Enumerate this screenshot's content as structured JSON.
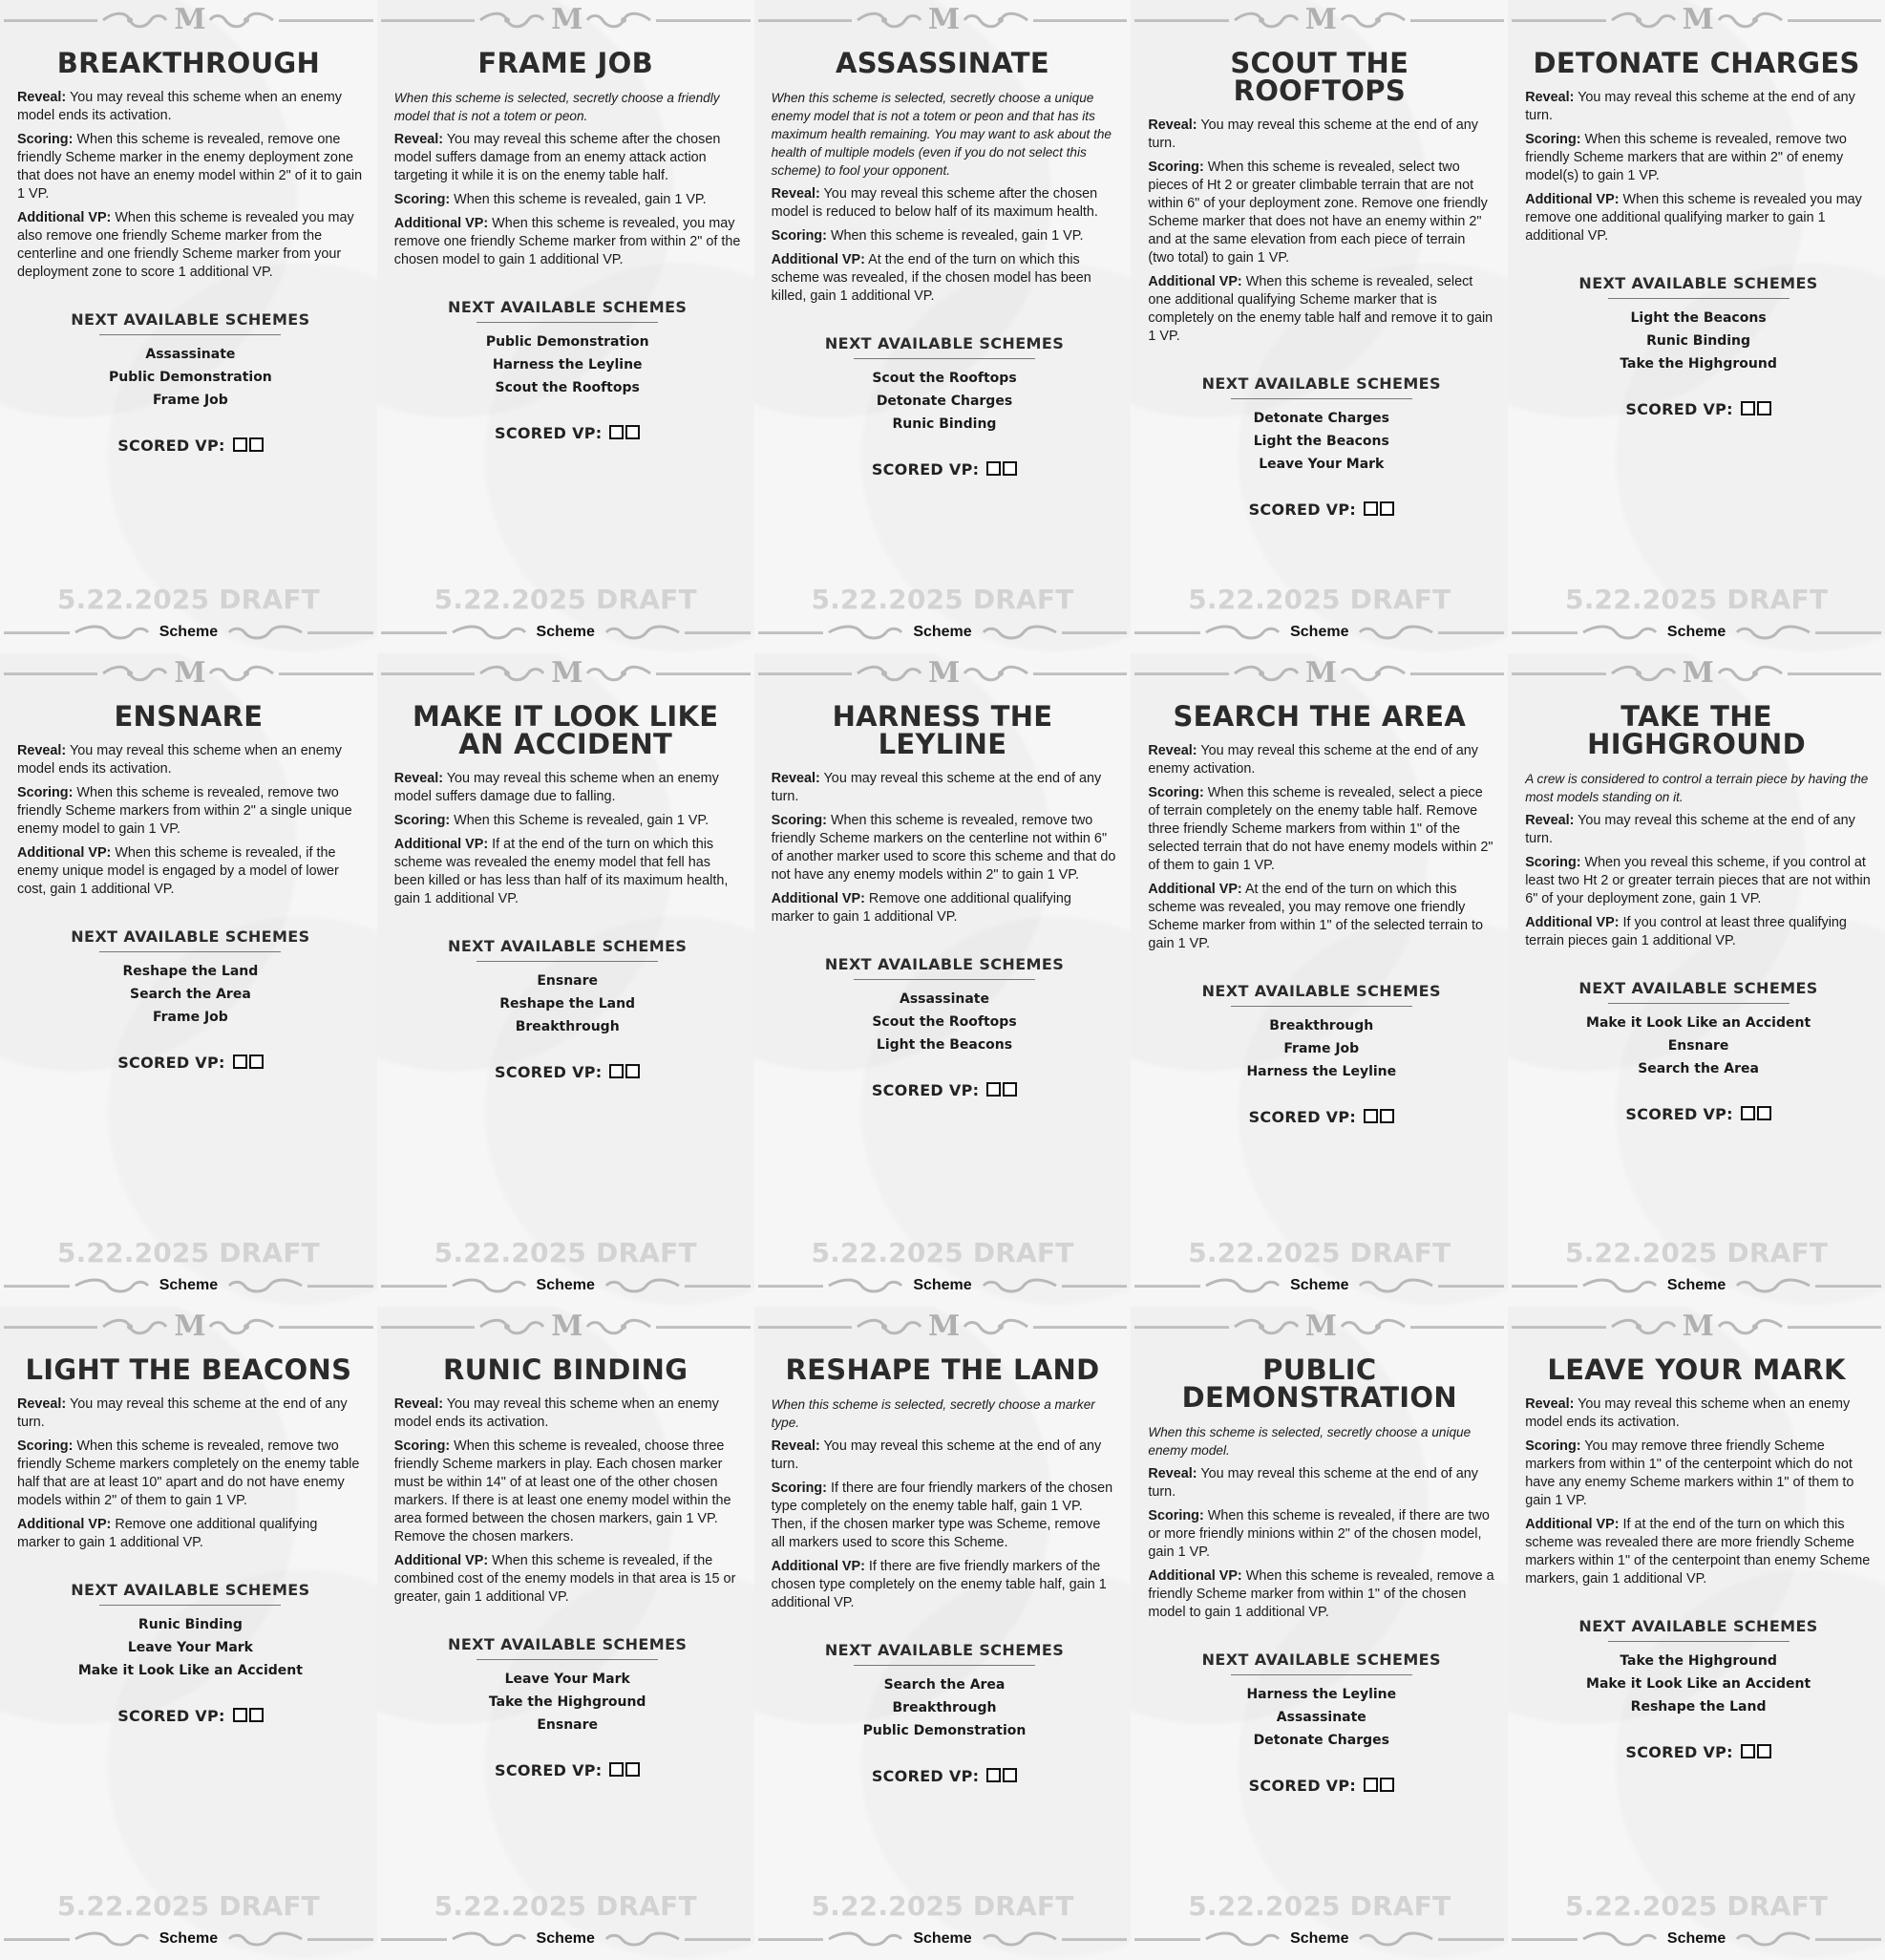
{
  "sheet": {
    "draft_label": "5.22.2025 DRAFT",
    "card_type": "Scheme",
    "next_heading": "NEXT AVAILABLE SCHEMES",
    "scored_label": "SCORED VP:",
    "logo_letter": "M"
  },
  "cards": [
    {
      "title": "BREAKTHROUGH",
      "paras": [
        {
          "label": "Reveal:",
          "text": " You may reveal this scheme when an enemy model ends its activation."
        },
        {
          "label": "Scoring:",
          "text": " When this scheme is revealed, remove one friendly Scheme marker in the enemy deployment zone that does not have an enemy model within 2\" of it to gain 1 VP."
        },
        {
          "label": "Additional VP:",
          "text": " When this scheme is revealed you may also remove one friendly Scheme marker from the centerline and one friendly Scheme marker from your deployment zone to score 1 additional VP."
        }
      ],
      "next": [
        "Assassinate",
        "Public Demonstration",
        "Frame Job"
      ]
    },
    {
      "title": "FRAME JOB",
      "intro": "When this scheme is selected, secretly choose a friendly model that is not a totem or peon.",
      "paras": [
        {
          "label": "Reveal:",
          "text": " You may reveal this scheme after the chosen model suffers damage from an enemy attack action targeting it while it is on the enemy table half."
        },
        {
          "label": "Scoring:",
          "text": " When this scheme is revealed, gain 1 VP."
        },
        {
          "label": "Additional VP:",
          "text": " When this scheme is revealed, you may remove one friendly Scheme marker from within 2\" of the chosen model to gain 1 additional VP."
        }
      ],
      "next": [
        "Public Demonstration",
        "Harness the Leyline",
        "Scout the Rooftops"
      ]
    },
    {
      "title": "ASSASSINATE",
      "intro": "When this scheme is selected, secretly choose a unique enemy model that is not a totem or peon and that has its maximum health remaining. You may want to ask about the health of multiple models (even if you do not select this scheme) to fool your opponent.",
      "paras": [
        {
          "label": "Reveal:",
          "text": " You may reveal this scheme after the chosen model is reduced to below half of its maximum health."
        },
        {
          "label": "Scoring:",
          "text": " When this scheme is revealed, gain 1 VP."
        },
        {
          "label": "Additional VP:",
          "text": " At the end of the turn on which this scheme was revealed, if the chosen model has been killed, gain 1 additional VP."
        }
      ],
      "next": [
        "Scout the Rooftops",
        "Detonate Charges",
        "Runic Binding"
      ]
    },
    {
      "title": "SCOUT THE ROOFTOPS",
      "paras": [
        {
          "label": "Reveal:",
          "text": " You may reveal this scheme at the end of any turn."
        },
        {
          "label": "Scoring:",
          "text": " When this scheme is revealed, select two pieces of Ht 2 or greater climbable terrain that are not within 6\" of your deployment zone. Remove one friendly Scheme marker that does not have an enemy within 2\" and at the same elevation from each piece of terrain (two total) to gain 1 VP."
        },
        {
          "label": "Additional VP:",
          "text": " When this scheme is revealed, select one additional qualifying Scheme marker that is completely on the enemy table half and remove it to gain 1 VP."
        }
      ],
      "next": [
        "Detonate Charges",
        "Light the Beacons",
        "Leave Your Mark"
      ]
    },
    {
      "title": "DETONATE CHARGES",
      "paras": [
        {
          "label": "Reveal:",
          "text": " You may reveal this scheme at the end of any turn."
        },
        {
          "label": "Scoring:",
          "text": " When this scheme is revealed, remove two friendly Scheme markers that are within 2\" of enemy model(s) to gain 1 VP."
        },
        {
          "label": "Additional VP:",
          "text": " When this scheme is revealed you may remove one additional qualifying marker to gain 1 additional VP."
        }
      ],
      "next": [
        "Light the Beacons",
        "Runic Binding",
        "Take the Highground"
      ]
    },
    {
      "title": "ENSNARE",
      "paras": [
        {
          "label": "Reveal:",
          "text": " You may reveal this scheme when an enemy model ends its activation."
        },
        {
          "label": "Scoring:",
          "text": " When this scheme is revealed, remove two friendly Scheme markers from within 2\" a single unique enemy model to gain 1 VP."
        },
        {
          "label": "Additional VP:",
          "text": " When this scheme is revealed, if the enemy unique model is engaged by a model of lower cost, gain 1 additional VP."
        }
      ],
      "next": [
        "Reshape the Land",
        "Search the Area",
        "Frame Job"
      ]
    },
    {
      "title": "MAKE IT LOOK LIKE AN ACCIDENT",
      "paras": [
        {
          "label": "Reveal:",
          "text": " You may reveal this scheme when an enemy model suffers damage due to falling."
        },
        {
          "label": "Scoring:",
          "text": " When this Scheme is revealed, gain 1 VP."
        },
        {
          "label": "Additional VP:",
          "text": " If at the end of the turn on which this scheme was revealed the enemy model that fell has been killed or has less than half of its maximum health, gain 1 additional VP."
        }
      ],
      "next": [
        "Ensnare",
        "Reshape the Land",
        "Breakthrough"
      ]
    },
    {
      "title": "HARNESS THE LEYLINE",
      "paras": [
        {
          "label": "Reveal:",
          "text": " You may reveal this scheme at the end of any turn."
        },
        {
          "label": "Scoring:",
          "text": " When this scheme is revealed, remove two friendly Scheme markers on the centerline not within 6\" of another marker used to score this scheme and that do not have any enemy models within 2\" to gain 1 VP."
        },
        {
          "label": "Additional VP:",
          "text": " Remove one additional qualifying marker to gain 1 additional VP."
        }
      ],
      "next": [
        "Assassinate",
        "Scout the Rooftops",
        "Light the Beacons"
      ]
    },
    {
      "title": "SEARCH THE AREA",
      "paras": [
        {
          "label": "Reveal:",
          "text": " You may reveal this scheme at the end of any enemy activation."
        },
        {
          "label": "Scoring:",
          "text": " When this scheme is revealed, select a piece of terrain completely on the enemy table half. Remove three friendly Scheme markers from within 1\" of the selected terrain that do not have enemy models within 2\" of them to gain 1 VP."
        },
        {
          "label": "Additional VP:",
          "text": " At the end of the turn on which this scheme was revealed, you may remove one friendly Scheme marker from within 1\" of the selected terrain to gain 1 VP."
        }
      ],
      "next": [
        "Breakthrough",
        "Frame Job",
        "Harness the Leyline"
      ]
    },
    {
      "title": "TAKE THE HIGHGROUND",
      "intro": "A crew is considered to control a terrain piece by having the most models standing on it.",
      "paras": [
        {
          "label": "Reveal:",
          "text": " You may reveal this scheme at the end of any turn."
        },
        {
          "label": "Scoring:",
          "text": " When you reveal this scheme, if you control at least two Ht 2 or greater terrain pieces that are not within 6\" of your deployment zone, gain 1 VP."
        },
        {
          "label": "Additional VP:",
          "text": " If you control at least three qualifying terrain pieces gain 1 additional VP."
        }
      ],
      "next": [
        "Make it Look Like an Accident",
        "Ensnare",
        "Search the Area"
      ]
    },
    {
      "title": "LIGHT THE BEACONS",
      "paras": [
        {
          "label": "Reveal:",
          "text": " You may reveal this scheme at the end of any turn."
        },
        {
          "label": "Scoring:",
          "text": " When this scheme is revealed, remove two friendly Scheme markers completely on the enemy table half that are at least 10\" apart and do not have enemy models within 2\" of them to gain 1 VP."
        },
        {
          "label": "Additional VP:",
          "text": " Remove one additional qualifying marker to gain 1 additional VP."
        }
      ],
      "next": [
        "Runic Binding",
        "Leave Your Mark",
        "Make it Look Like an Accident"
      ]
    },
    {
      "title": "RUNIC BINDING",
      "paras": [
        {
          "label": "Reveal:",
          "text": " You may reveal this scheme when an enemy model ends its activation."
        },
        {
          "label": "Scoring:",
          "text": " When this scheme is revealed, choose three friendly Scheme markers in play. Each chosen marker must be within 14\" of at least one of the other chosen markers. If there is at least one enemy model within the area formed between the chosen markers, gain 1 VP. Remove the chosen markers."
        },
        {
          "label": "Additional VP:",
          "text": " When this scheme is revealed, if the combined cost of the enemy models in that area is 15 or greater, gain 1 additional VP."
        }
      ],
      "next": [
        "Leave Your Mark",
        "Take the Highground",
        "Ensnare"
      ]
    },
    {
      "title": "RESHAPE THE LAND",
      "intro": "When this scheme is selected, secretly choose a marker type.",
      "paras": [
        {
          "label": "Reveal:",
          "text": " You may reveal this scheme at the end of any turn."
        },
        {
          "label": "Scoring:",
          "text": " If there are four friendly markers of the chosen type completely on the enemy table half, gain 1 VP. Then, if the chosen marker type was Scheme, remove all markers used to score this Scheme."
        },
        {
          "label": "Additional VP:",
          "text": " If there are five friendly markers of the chosen type completely on the enemy table half, gain 1 additional VP."
        }
      ],
      "next": [
        "Search the Area",
        "Breakthrough",
        "Public Demonstration"
      ]
    },
    {
      "title": "PUBLIC DEMONSTRATION",
      "intro": "When this scheme is selected, secretly choose a unique enemy model.",
      "paras": [
        {
          "label": "Reveal:",
          "text": " You may reveal this scheme at the end of any turn."
        },
        {
          "label": "Scoring:",
          "text": " When this scheme is revealed, if there are two or more friendly minions within 2\" of the chosen model, gain 1 VP."
        },
        {
          "label": "Additional VP:",
          "text": " When this scheme is revealed, remove a friendly Scheme marker from within 1\" of the chosen model to gain 1 additional VP."
        }
      ],
      "next": [
        "Harness the Leyline",
        "Assassinate",
        "Detonate Charges"
      ]
    },
    {
      "title": "LEAVE YOUR MARK",
      "paras": [
        {
          "label": "Reveal:",
          "text": " You may reveal this scheme when an enemy model ends its activation."
        },
        {
          "label": "Scoring:",
          "text": " You may remove three friendly Scheme markers from within 1\" of the centerpoint which do not have any enemy Scheme markers within 1\" of them to gain 1 VP."
        },
        {
          "label": "Additional VP:",
          "text": " If at the end of the turn on which this scheme was revealed there are more friendly Scheme markers within 1\" of the centerpoint than enemy Scheme markers, gain 1 additional VP."
        }
      ],
      "next": [
        "Take the Highground",
        "Make it Look Like an Accident",
        "Reshape the Land"
      ]
    }
  ]
}
